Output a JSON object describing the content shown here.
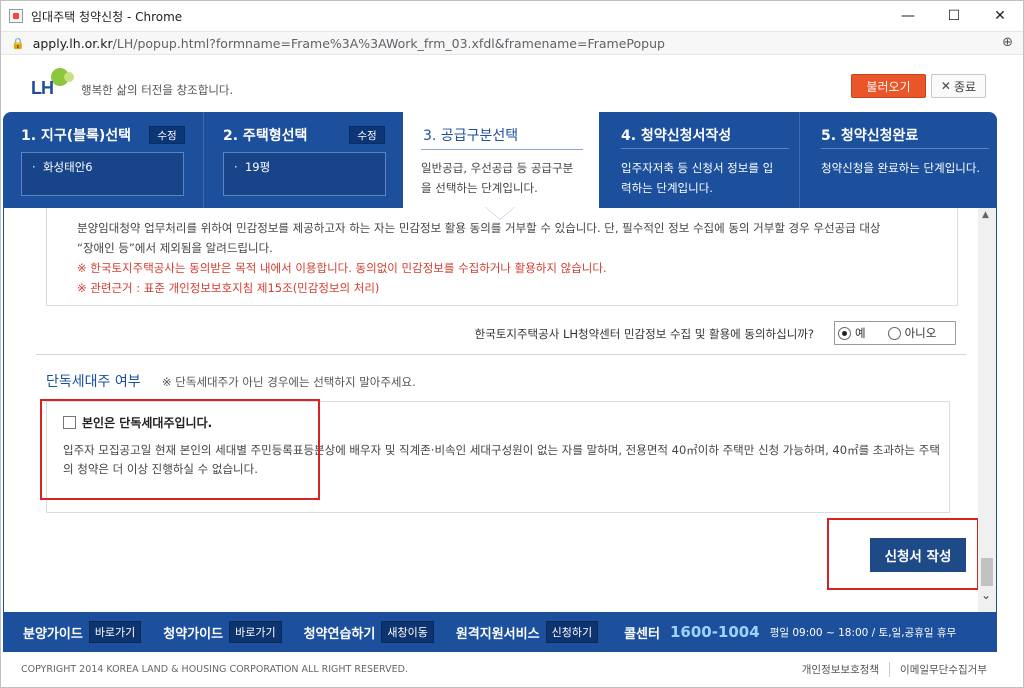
{
  "window": {
    "title": "임대주택 청약신청 - Chrome",
    "minimize": "—",
    "maximize": "☐",
    "close": "✕"
  },
  "address": {
    "host": "apply.lh.or.kr",
    "path": "/LH/popup.html?formname=Frame%3A%3AWork_frm_03.xfdl&framename=FramePopup"
  },
  "header": {
    "logo_text": "LH",
    "slogan": "행복한 삶의 터전을 창조합니다.",
    "load_button": "불러오기",
    "close_button": "종료"
  },
  "steps": [
    {
      "title": "1. 지구(블록)선택",
      "edit": "수정",
      "value": "화성태안6"
    },
    {
      "title": "2. 주택형선택",
      "edit": "수정",
      "value": "19평"
    },
    {
      "title": "3. 공급구분선택",
      "desc": "일반공급, 우선공급 등 공급구분을 선택하는 단계입니다."
    },
    {
      "title": "4. 청약신청서작성",
      "desc": "입주자저축 등 신청서 정보를 입력하는 단계입니다."
    },
    {
      "title": "5. 청약신청완료",
      "desc": "청약신청을 완료하는 단계입니다."
    }
  ],
  "privacy": {
    "line1": "분양임대청약 업무처리를 위하여 민감정보를 제공하고자 하는 자는 민감정보 활용 동의를 거부할 수 있습니다. 단, 필수적인 정보 수집에 동의 거부할 경우 우선공급 대상",
    "line2": "“장애인 등”에서 제외됨을 알려드립니다.",
    "notice1": "※ 한국토지주택공사는 동의받은 목적 내에서 이용합니다. 동의없이 민감정보를 수집하거나 활용하지 않습니다.",
    "notice2": "※ 관련근거 : 표준 개인정보보호지침 제15조(민감정보의 처리)",
    "consent_question": "한국토지주택공사 LH청약센터 민감정보 수집 및 활용에 동의하십니까?",
    "yes": "예",
    "no": "아니오"
  },
  "single_household": {
    "title": "단독세대주 여부",
    "note": "※ 단독세대주가 아닌 경우에는 선택하지 말아주세요.",
    "checkbox_label": "본인은 단독세대주입니다.",
    "description": "입주자 모집공고일 현재 본인의 세대별 주민등록표등본상에 배우자 및 직계존·비속인 세대구성원이 없는 자를 말하며, 전용면적 40㎡이하 주택만 신청 가능하며, 40㎡를 초과하는 주택의 청약은 더 이상 진행하실 수 없습니다."
  },
  "submit_button": "신청서 작성",
  "footer": {
    "items": [
      {
        "label": "분양가이드",
        "btn": "바로가기"
      },
      {
        "label": "청약가이드",
        "btn": "바로가기"
      },
      {
        "label": "청약연습하기",
        "btn": "새창이동"
      },
      {
        "label": "원격지원서비스",
        "btn": "신청하기"
      }
    ],
    "call_label": "콜센터",
    "call_number": "1600-1004",
    "call_hours": "평일 09:00 ~ 18:00 / 토,일,공휴일 휴무",
    "copyright": "COPYRIGHT 2014 KOREA LAND & HOUSING CORPORATION ALL RIGHT RESERVED.",
    "link1": "개인정보보호정책",
    "link2": "이메일무단수집거부"
  }
}
